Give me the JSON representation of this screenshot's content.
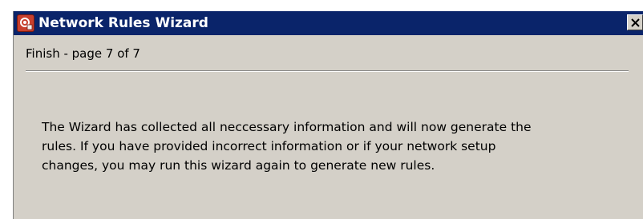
{
  "window": {
    "title": "Network Rules Wizard",
    "app_icon": "wizard-app-icon",
    "close_icon": "close-x-icon"
  },
  "page": {
    "label": "Finish - page 7 of 7"
  },
  "message": {
    "lines": [
      "The Wizard has collected all neccessary information and will now generate the",
      "rules. If you have provided incorrect information or if your network setup",
      "changes, you may run this wizard again to generate new rules."
    ]
  },
  "colors": {
    "titlebar": "#0a246a",
    "dialog_background": "#d4d0c8",
    "title_text": "#ffffff"
  }
}
